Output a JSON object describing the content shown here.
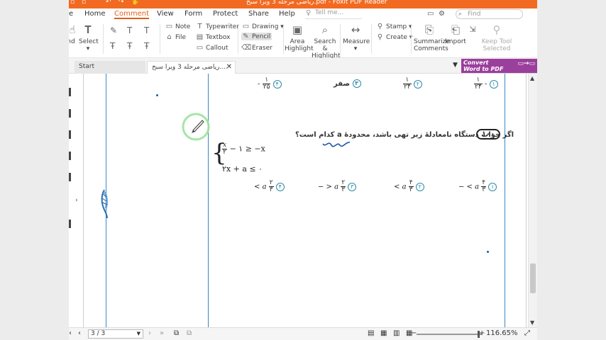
{
  "titlebar": {
    "title": "ریاضی مرحله 3 ویرا سبح.pdf - Foxit PDF Reader",
    "quick_access_icons": [
      "save-icon",
      "print-icon",
      "undo-icon",
      "redo-icon",
      "hand-icon",
      "select-icon"
    ],
    "color": "#f26a21"
  },
  "menubar": {
    "items": [
      "e",
      "Home",
      "Comment",
      "View",
      "Form",
      "Protect",
      "Share",
      "Help"
    ],
    "active": "Comment",
    "tellme_placeholder": "Tell me...",
    "find_placeholder": "Find"
  },
  "ribbon": {
    "hand_label": "nd",
    "select_label": "Select",
    "note_label": "Note",
    "file_label": "File",
    "typewriter_label": "Typewriter",
    "textbox_label": "Textbox",
    "callout_label": "Callout",
    "drawing_label": "Drawing",
    "pencil_label": "Pencil",
    "eraser_label": "Eraser",
    "area_highlight_label": "Area Highlight",
    "search_highlight_label": "Search & Highlight",
    "measure_label": "Measure",
    "stamp_label": "Stamp",
    "create_label": "Create",
    "summarize_label": "Summarize Comments",
    "import_label": "Import",
    "keep_tool_label": "Keep Tool Selected"
  },
  "tabs": {
    "start": "Start",
    "document": "ریاضی مرحله 3 ویرا سبح....",
    "convert_line1": "Convert",
    "convert_line2": "Word to PDF"
  },
  "document": {
    "prev_options": {
      "opt1": {
        "marker": "۱",
        "num": "۱",
        "den": "۲۴",
        "sign": "-"
      },
      "opt2": {
        "marker": "۲",
        "num": "۱",
        "den": "۲۴",
        "sign": ""
      },
      "opt3": {
        "marker": "۳",
        "text": "صفر"
      },
      "opt4": {
        "marker": "۴",
        "num": "۱",
        "den": "۲۵",
        "sign": "-"
      }
    },
    "question_number": "۱۰۰",
    "question_text": "اگر جواب دستگاه نامعادلهٔ زیر تهی باشد، محدودهٔ a کدام است؟",
    "system_line1_num": "x",
    "system_line1_den": "۲",
    "system_line1_rest": "− ۱ ≥ −x",
    "system_line2": "۲x + a ≤ ۰",
    "options": {
      "opt1": {
        "marker": "۱",
        "lhs": "a > −",
        "num": "۴",
        "den": "۳"
      },
      "opt2": {
        "marker": "۲",
        "lhs": "a >",
        "num": "۴",
        "den": "۳"
      },
      "opt3": {
        "marker": "۳",
        "lhs": "a < −",
        "num": "۲",
        "den": "۳"
      },
      "opt4": {
        "marker": "۴",
        "lhs": "a >",
        "num": "۲",
        "den": "۳"
      }
    }
  },
  "statusbar": {
    "page_indicator": "3 / 3",
    "zoom": "116.65%",
    "minus": "−",
    "plus": "+"
  }
}
